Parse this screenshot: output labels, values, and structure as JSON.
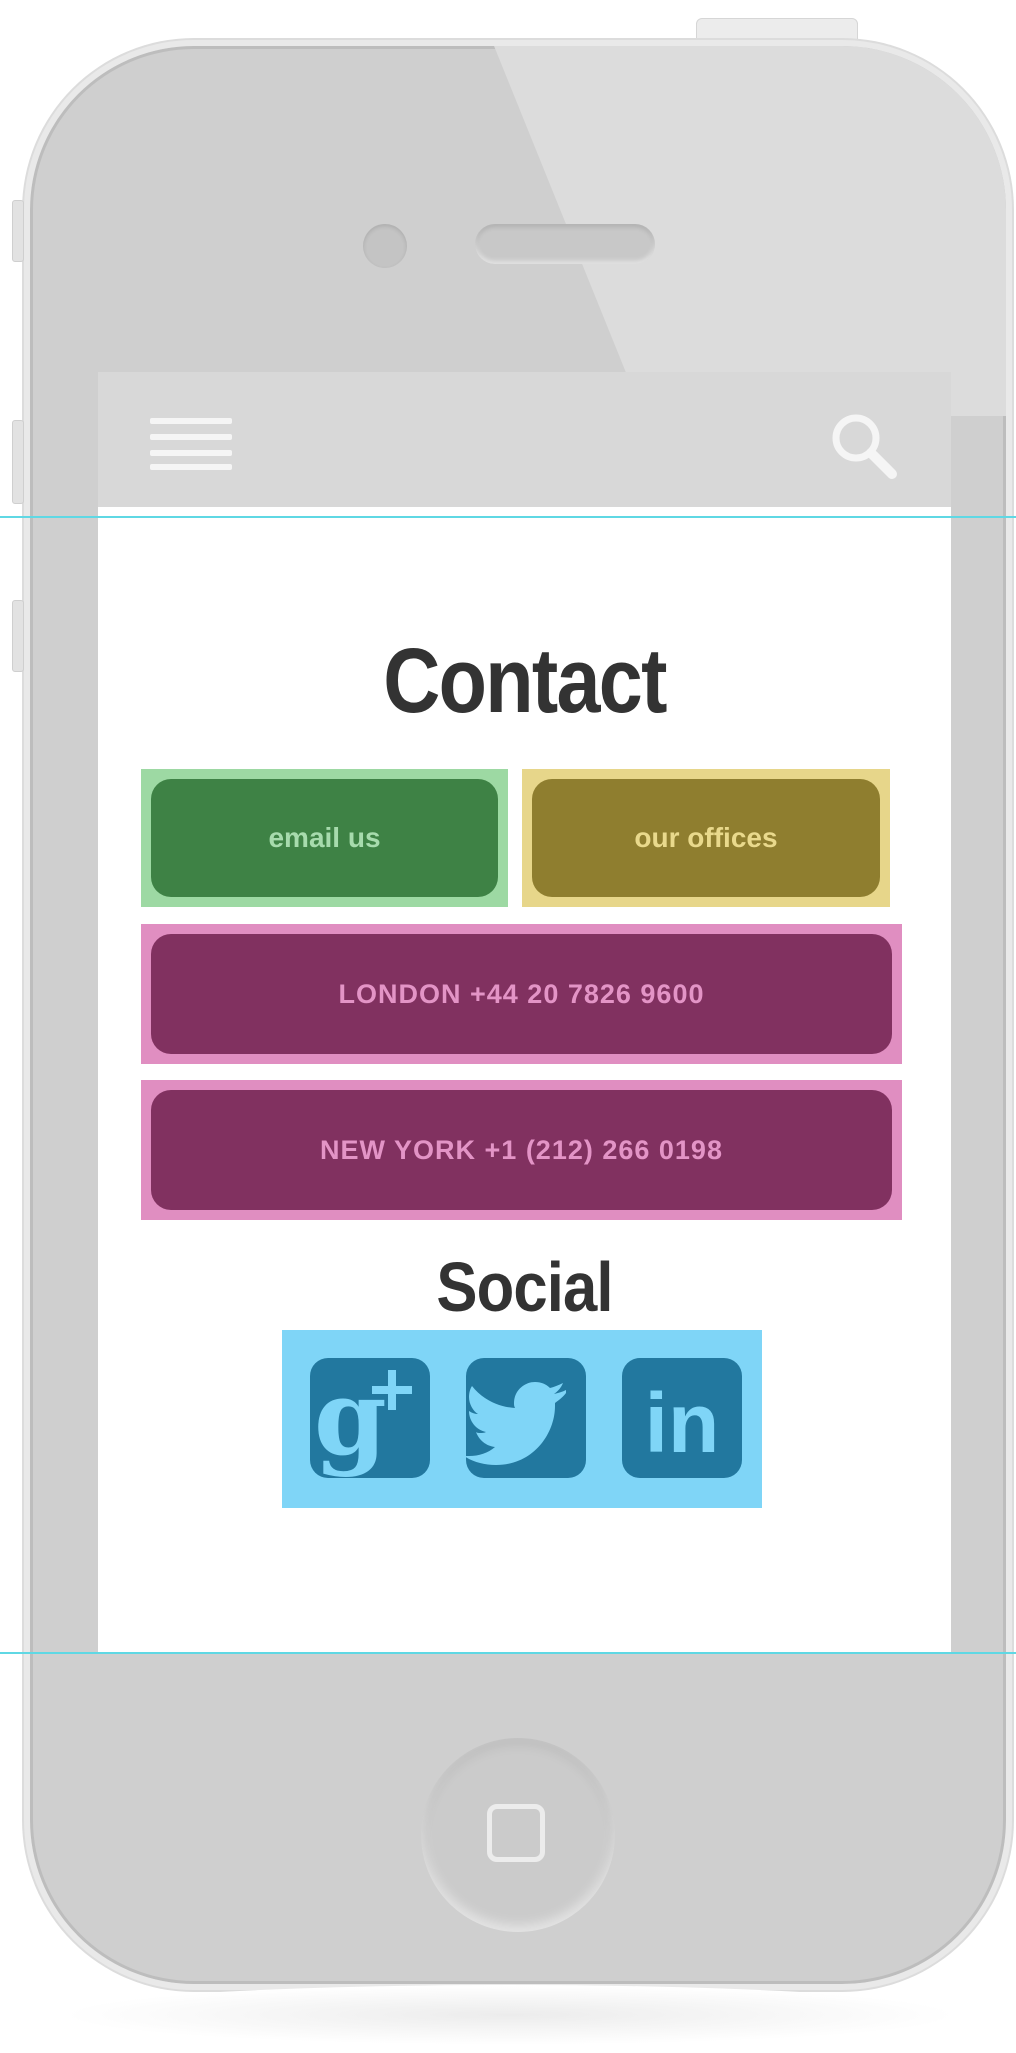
{
  "colors": {
    "email_outer": "#9dd9a3",
    "email_button": "#3e8245",
    "offices_outer": "#e7d68a",
    "offices_button": "#8f7e2f",
    "phone_outer": "#e08ec1",
    "phone_button": "#813160",
    "social_box": "#7fd5f7",
    "social_icon": "#22789f",
    "guide_line": "#5fd8e4"
  },
  "header": {
    "menu_icon": "hamburger-menu-icon",
    "search_icon": "search-icon"
  },
  "contact": {
    "title": "Contact",
    "email_label": "email us",
    "offices_label": "our offices",
    "london_label": "LONDON +44 20 7826 9600",
    "newyork_label": "NEW YORK +1 (212) 266 0198"
  },
  "social": {
    "title": "Social",
    "icons": [
      "google-plus-icon",
      "twitter-icon",
      "linkedin-icon"
    ],
    "linkedin_glyph": "in"
  }
}
